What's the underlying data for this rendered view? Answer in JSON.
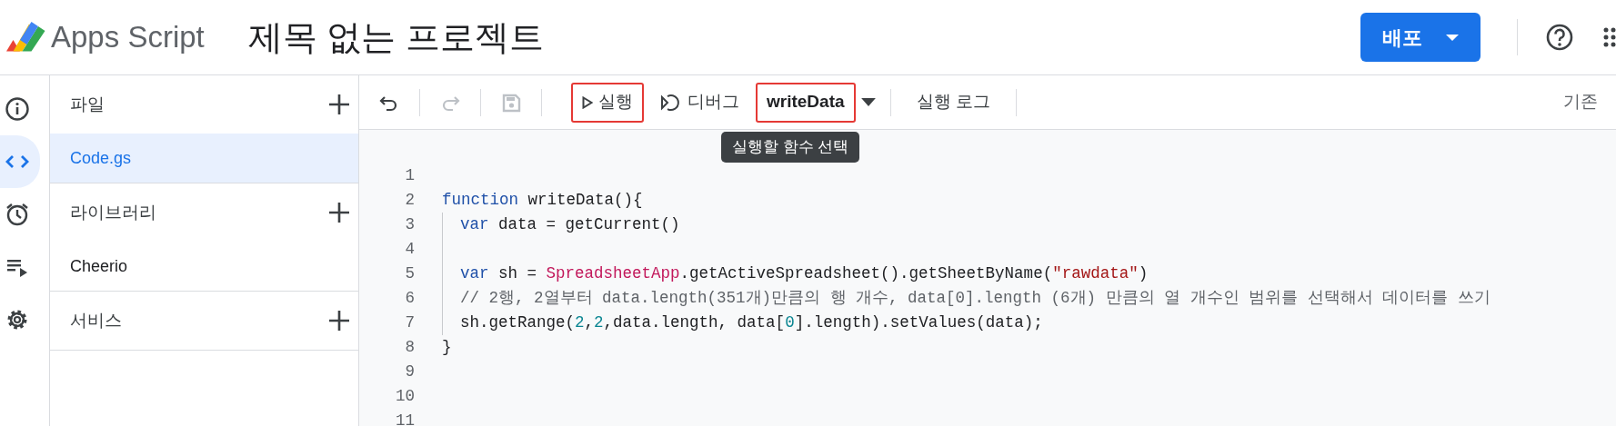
{
  "header": {
    "logo_text": "Apps Script",
    "project_title": "제목 없는 프로젝트",
    "deploy_button": "배포"
  },
  "rail": [
    {
      "kind": "info",
      "selected": false
    },
    {
      "kind": "code",
      "selected": true
    },
    {
      "kind": "clock",
      "selected": false
    },
    {
      "kind": "executions",
      "selected": false
    },
    {
      "kind": "settings",
      "selected": false
    }
  ],
  "files_panel": [
    {
      "title": "파일",
      "addable": true,
      "items": [
        {
          "label": "Code.gs",
          "selected": true
        }
      ]
    },
    {
      "title": "라이브러리",
      "addable": true,
      "items": [
        {
          "label": "Cheerio",
          "selected": false
        }
      ]
    },
    {
      "title": "서비스",
      "addable": true
    }
  ],
  "toolbar": {
    "icon_buttons": [
      {
        "kind": "undo",
        "disabled": false
      },
      {
        "kind": "redo",
        "disabled": true
      },
      {
        "kind": "save",
        "disabled": true
      }
    ],
    "run": {
      "label": "실행",
      "highlighted": true
    },
    "debug": {
      "label": "디버그"
    },
    "function_select": {
      "value": "writeData",
      "highlighted": true
    },
    "tooltip": "실행할 함수 선택",
    "log": "실행 로그",
    "cut_text": "기존"
  },
  "code_lines": [
    {
      "number": "1",
      "indent": false
    },
    {
      "number": "2",
      "indent": false,
      "segments": [
        {
          "kind": "keyword",
          "text": "function"
        },
        {
          "kind": "plain",
          "text": " writeData(){"
        }
      ]
    },
    {
      "number": "3",
      "indent": true,
      "segments": [
        {
          "kind": "keyword",
          "text": "var"
        },
        {
          "kind": "plain",
          "text": " data = getCurrent()"
        }
      ]
    },
    {
      "number": "4",
      "indent": true
    },
    {
      "number": "5",
      "indent": true,
      "segments": [
        {
          "kind": "keyword",
          "text": "var"
        },
        {
          "kind": "plain",
          "text": " sh = "
        },
        {
          "kind": "class",
          "text": "SpreadsheetApp"
        },
        {
          "kind": "plain",
          "text": ".getActiveSpreadsheet().getSheetByName("
        },
        {
          "kind": "string",
          "text": "\"rawdata\""
        },
        {
          "kind": "plain",
          "text": ")"
        }
      ]
    },
    {
      "number": "6",
      "indent": true,
      "segments": [
        {
          "kind": "comment",
          "text": "// 2행, 2열부터 data.length(351개)만큼의 행 개수, data[0].length (6개) 만큼의 열 개수인 범위를 선택해서 데이터를 쓰기"
        }
      ]
    },
    {
      "number": "7",
      "indent": true,
      "segments": [
        {
          "kind": "plain",
          "text": "sh.getRange("
        },
        {
          "kind": "number",
          "text": "2"
        },
        {
          "kind": "plain",
          "text": ","
        },
        {
          "kind": "number",
          "text": "2"
        },
        {
          "kind": "plain",
          "text": ",data.length, data["
        },
        {
          "kind": "number",
          "text": "0"
        },
        {
          "kind": "plain",
          "text": "].length).setValues(data);"
        }
      ]
    },
    {
      "number": "8",
      "indent": false,
      "segments": [
        {
          "kind": "plain",
          "text": "}"
        }
      ]
    },
    {
      "number": "9",
      "indent": false
    },
    {
      "number": "10",
      "indent": false
    },
    {
      "number": "11",
      "indent": false
    }
  ]
}
